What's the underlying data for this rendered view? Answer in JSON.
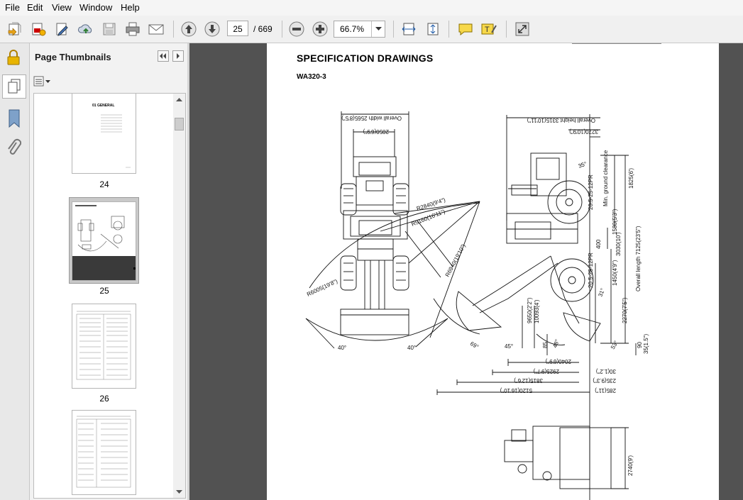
{
  "menu": [
    "File",
    "Edit",
    "View",
    "Window",
    "Help"
  ],
  "toolbar": {
    "page_current": "25",
    "page_total": "/ 669",
    "zoom": "66.7%"
  },
  "panel": {
    "title": "Page Thumbnails",
    "thumbnails": [
      {
        "label": "24",
        "heading": "01 GENERAL"
      },
      {
        "label": "25",
        "heading": ""
      },
      {
        "label": "26",
        "heading": ""
      },
      {
        "label": "",
        "heading": ""
      }
    ]
  },
  "document": {
    "heading": "SPECIFICATION DRAWINGS",
    "model": "WA320-3",
    "dimensions": {
      "overall_width": "Overall width 2565(8'5\")",
      "tread": "2050(6'9\")",
      "overall_height": "Overall height 3315(10'11\")",
      "cab_height": "3270(10'9\")",
      "r2840": "R2840(9'4\")",
      "r5160": "R5160(16'11\")",
      "r6940": "R6940(19'10\")",
      "r6005": "R6005(19'8\")",
      "angle_left": "40°",
      "angle_right": "40°",
      "min_clearance": "Min. ground clearance",
      "tire": "20.5-25-12PR",
      "h1825": "1825(6')",
      "h1580": "1580(5'3\")",
      "h3030": "3030(10')",
      "h1450": "1450(4'9\")",
      "h2270": "2270(7'5\")",
      "overall_length": "Overall length 7125(23'5\")",
      "d400": "400",
      "d9650": "9650(2'2\")",
      "d10093": "10093(4')",
      "d85": "85",
      "d2040": "2040(6'9\")",
      "d2925": "2925(9'7\")",
      "d3815": "3815(12'6\")",
      "d5120": "5120(16'10\")",
      "d30": "30(1.2\")",
      "d235": "235(9.3\")",
      "d285": "285(11\")",
      "d90": "90",
      "d35": "35(1.5\")",
      "d2740": "2740(9')",
      "a45": "45°",
      "a48": "48°",
      "a35": "35°",
      "a31": "31°",
      "a53": "53°",
      "a69": "69°"
    }
  }
}
